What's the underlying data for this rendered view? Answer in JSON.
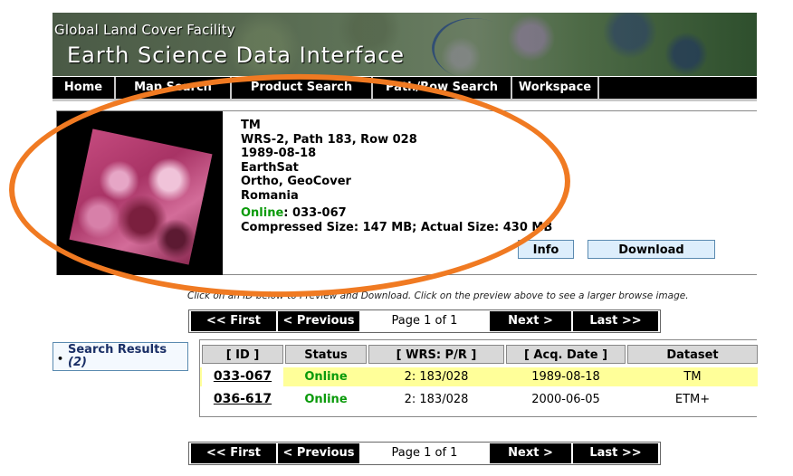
{
  "banner": {
    "line1": "Global Land Cover Facility",
    "line2": "Earth Science Data Interface"
  },
  "nav": {
    "items": [
      "Home",
      "Map Search",
      "Product Search",
      "Path/Row Search",
      "Workspace"
    ]
  },
  "detail": {
    "sensor": "TM",
    "wrs": "WRS-2, Path 183, Row 028",
    "date": "1989-08-18",
    "provider": "EarthSat",
    "product": "Ortho, GeoCover",
    "country": "Romania",
    "status_label": "Online",
    "status_suffix": ": 033-067",
    "size": "Compressed Size: 147 MB; Actual Size: 430 MB",
    "info_button": "Info",
    "download_button": "Download"
  },
  "hint": "Click on an ID below to Preview and Download. Click on the preview above to see a larger browse image.",
  "pager": {
    "first": "<< First",
    "previous": "< Previous",
    "page": "Page 1 of 1",
    "next": "Next >",
    "last": "Last >>"
  },
  "sidebar": {
    "label": "Search Results",
    "count": "(2)"
  },
  "results": {
    "headers": [
      "[ ID ]",
      "Status",
      "[ WRS: P/R ]",
      "[ Acq. Date ]",
      "Dataset"
    ],
    "rows": [
      {
        "id": "033-067",
        "status": "Online",
        "wrs": "2: 183/028",
        "date": "1989-08-18",
        "dataset": "TM"
      },
      {
        "id": "036-617",
        "status": "Online",
        "wrs": "2: 183/028",
        "date": "2000-06-05",
        "dataset": "ETM+"
      }
    ]
  },
  "colors": {
    "accent_circle": "#f07a22",
    "online": "#0a9a0a",
    "selected_row": "#ffff99",
    "nav_bg": "#000000"
  }
}
